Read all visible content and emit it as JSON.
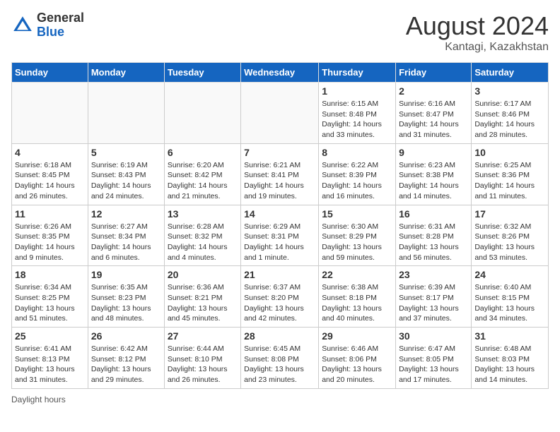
{
  "header": {
    "logo_general": "General",
    "logo_blue": "Blue",
    "month_year": "August 2024",
    "location": "Kantagi, Kazakhstan"
  },
  "days_of_week": [
    "Sunday",
    "Monday",
    "Tuesday",
    "Wednesday",
    "Thursday",
    "Friday",
    "Saturday"
  ],
  "weeks": [
    [
      {
        "day": "",
        "info": ""
      },
      {
        "day": "",
        "info": ""
      },
      {
        "day": "",
        "info": ""
      },
      {
        "day": "",
        "info": ""
      },
      {
        "day": "1",
        "info": "Sunrise: 6:15 AM\nSunset: 8:48 PM\nDaylight: 14 hours and 33 minutes."
      },
      {
        "day": "2",
        "info": "Sunrise: 6:16 AM\nSunset: 8:47 PM\nDaylight: 14 hours and 31 minutes."
      },
      {
        "day": "3",
        "info": "Sunrise: 6:17 AM\nSunset: 8:46 PM\nDaylight: 14 hours and 28 minutes."
      }
    ],
    [
      {
        "day": "4",
        "info": "Sunrise: 6:18 AM\nSunset: 8:45 PM\nDaylight: 14 hours and 26 minutes."
      },
      {
        "day": "5",
        "info": "Sunrise: 6:19 AM\nSunset: 8:43 PM\nDaylight: 14 hours and 24 minutes."
      },
      {
        "day": "6",
        "info": "Sunrise: 6:20 AM\nSunset: 8:42 PM\nDaylight: 14 hours and 21 minutes."
      },
      {
        "day": "7",
        "info": "Sunrise: 6:21 AM\nSunset: 8:41 PM\nDaylight: 14 hours and 19 minutes."
      },
      {
        "day": "8",
        "info": "Sunrise: 6:22 AM\nSunset: 8:39 PM\nDaylight: 14 hours and 16 minutes."
      },
      {
        "day": "9",
        "info": "Sunrise: 6:23 AM\nSunset: 8:38 PM\nDaylight: 14 hours and 14 minutes."
      },
      {
        "day": "10",
        "info": "Sunrise: 6:25 AM\nSunset: 8:36 PM\nDaylight: 14 hours and 11 minutes."
      }
    ],
    [
      {
        "day": "11",
        "info": "Sunrise: 6:26 AM\nSunset: 8:35 PM\nDaylight: 14 hours and 9 minutes."
      },
      {
        "day": "12",
        "info": "Sunrise: 6:27 AM\nSunset: 8:34 PM\nDaylight: 14 hours and 6 minutes."
      },
      {
        "day": "13",
        "info": "Sunrise: 6:28 AM\nSunset: 8:32 PM\nDaylight: 14 hours and 4 minutes."
      },
      {
        "day": "14",
        "info": "Sunrise: 6:29 AM\nSunset: 8:31 PM\nDaylight: 14 hours and 1 minute."
      },
      {
        "day": "15",
        "info": "Sunrise: 6:30 AM\nSunset: 8:29 PM\nDaylight: 13 hours and 59 minutes."
      },
      {
        "day": "16",
        "info": "Sunrise: 6:31 AM\nSunset: 8:28 PM\nDaylight: 13 hours and 56 minutes."
      },
      {
        "day": "17",
        "info": "Sunrise: 6:32 AM\nSunset: 8:26 PM\nDaylight: 13 hours and 53 minutes."
      }
    ],
    [
      {
        "day": "18",
        "info": "Sunrise: 6:34 AM\nSunset: 8:25 PM\nDaylight: 13 hours and 51 minutes."
      },
      {
        "day": "19",
        "info": "Sunrise: 6:35 AM\nSunset: 8:23 PM\nDaylight: 13 hours and 48 minutes."
      },
      {
        "day": "20",
        "info": "Sunrise: 6:36 AM\nSunset: 8:21 PM\nDaylight: 13 hours and 45 minutes."
      },
      {
        "day": "21",
        "info": "Sunrise: 6:37 AM\nSunset: 8:20 PM\nDaylight: 13 hours and 42 minutes."
      },
      {
        "day": "22",
        "info": "Sunrise: 6:38 AM\nSunset: 8:18 PM\nDaylight: 13 hours and 40 minutes."
      },
      {
        "day": "23",
        "info": "Sunrise: 6:39 AM\nSunset: 8:17 PM\nDaylight: 13 hours and 37 minutes."
      },
      {
        "day": "24",
        "info": "Sunrise: 6:40 AM\nSunset: 8:15 PM\nDaylight: 13 hours and 34 minutes."
      }
    ],
    [
      {
        "day": "25",
        "info": "Sunrise: 6:41 AM\nSunset: 8:13 PM\nDaylight: 13 hours and 31 minutes."
      },
      {
        "day": "26",
        "info": "Sunrise: 6:42 AM\nSunset: 8:12 PM\nDaylight: 13 hours and 29 minutes."
      },
      {
        "day": "27",
        "info": "Sunrise: 6:44 AM\nSunset: 8:10 PM\nDaylight: 13 hours and 26 minutes."
      },
      {
        "day": "28",
        "info": "Sunrise: 6:45 AM\nSunset: 8:08 PM\nDaylight: 13 hours and 23 minutes."
      },
      {
        "day": "29",
        "info": "Sunrise: 6:46 AM\nSunset: 8:06 PM\nDaylight: 13 hours and 20 minutes."
      },
      {
        "day": "30",
        "info": "Sunrise: 6:47 AM\nSunset: 8:05 PM\nDaylight: 13 hours and 17 minutes."
      },
      {
        "day": "31",
        "info": "Sunrise: 6:48 AM\nSunset: 8:03 PM\nDaylight: 13 hours and 14 minutes."
      }
    ]
  ],
  "footer": {
    "note": "Daylight hours"
  }
}
